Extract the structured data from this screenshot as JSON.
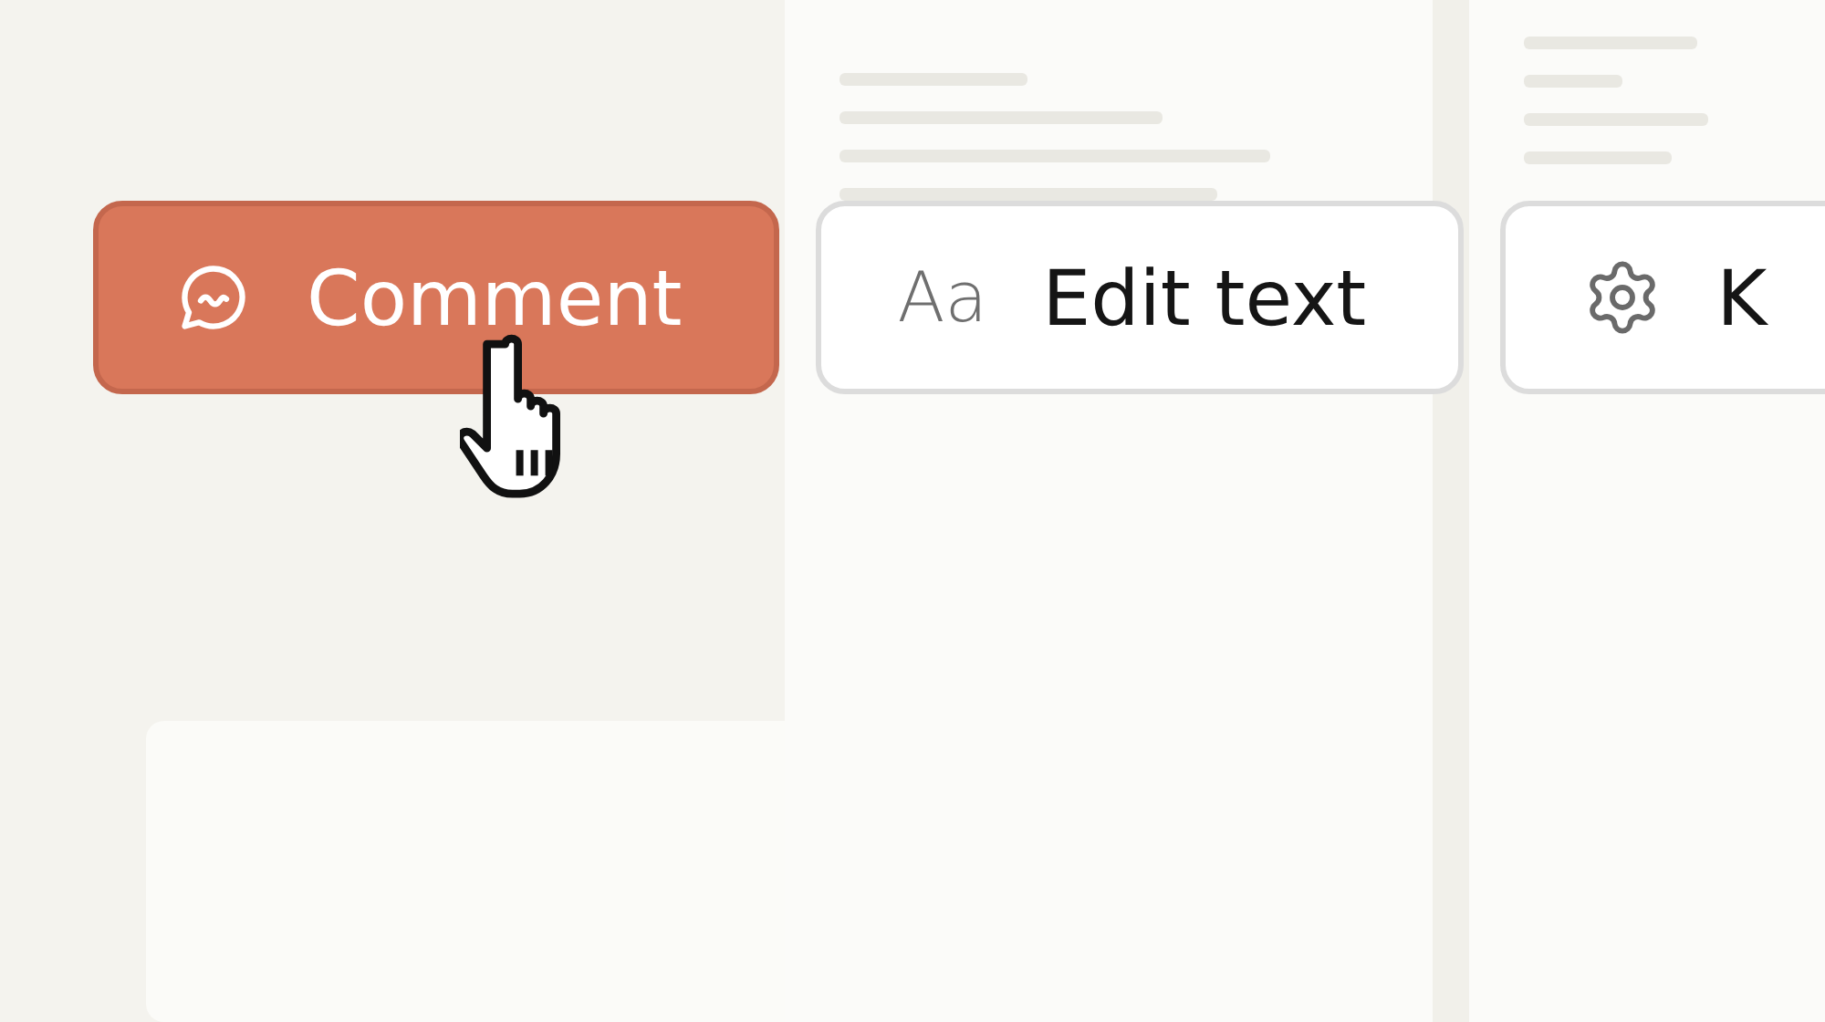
{
  "toolbar": {
    "buttons": [
      {
        "kind": "comment",
        "label": "Comment",
        "selected": true
      },
      {
        "kind": "text",
        "label": "Edit text",
        "icon_text": "Aa",
        "selected": false
      },
      {
        "kind": "settings",
        "label": "K",
        "selected": false
      }
    ]
  }
}
